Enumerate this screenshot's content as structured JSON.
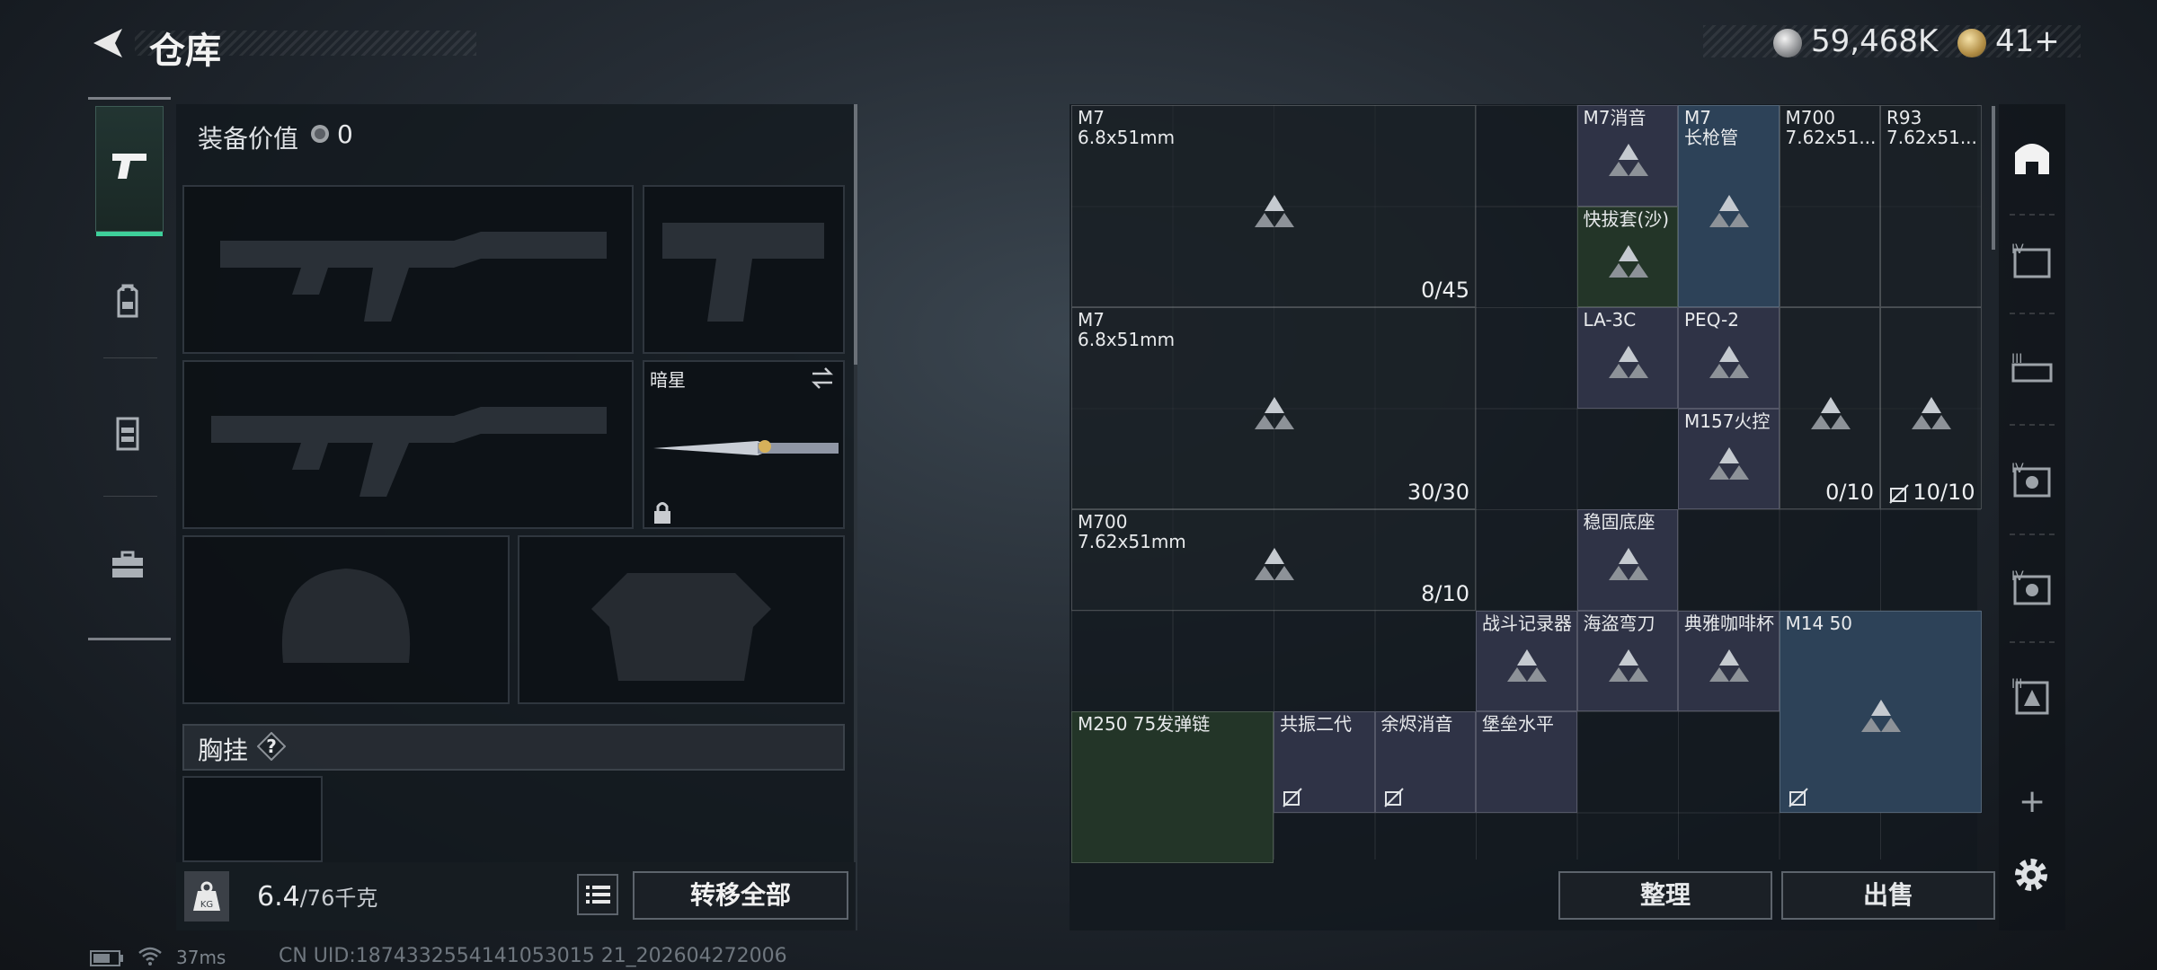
{
  "header": {
    "title": "仓库",
    "currency_value": "59,468K",
    "token_value": "41+"
  },
  "nav": {
    "items": [
      "weapon-tab",
      "backpack-tab",
      "vest-tab",
      "case-tab"
    ]
  },
  "equipment": {
    "value_label": "装备价值",
    "value": "0",
    "melee_name": "暗星",
    "chest_label": "胸挂",
    "chest_help": "?",
    "weight_value": "6.4",
    "weight_capacity": "/76千克",
    "transfer_all": "转移全部"
  },
  "storage": {
    "items": [
      {
        "name": "M7\n6.8x51mm",
        "count": "0/45"
      },
      {
        "name": "M7消音",
        "count": ""
      },
      {
        "name": "M7\n长枪管",
        "count": ""
      },
      {
        "name": "M700\n7.62x51...",
        "count": ""
      },
      {
        "name": "R93\n7.62x51...",
        "count": ""
      },
      {
        "name": "快拔套(沙)",
        "count": ""
      },
      {
        "name": "M7\n6.8x51mm",
        "count": "30/30"
      },
      {
        "name": "LA-3C",
        "count": ""
      },
      {
        "name": "PEQ-2",
        "count": ""
      },
      {
        "name": "M157火控",
        "count": ""
      },
      {
        "name": "M700\n7.62x51mm",
        "count": "8/10"
      },
      {
        "name": "稳固底座",
        "count": ""
      },
      {
        "name": "",
        "count": "0/10"
      },
      {
        "name": "",
        "count": "10/10"
      },
      {
        "name": "战斗记录器",
        "count": ""
      },
      {
        "name": "海盗弯刀",
        "count": ""
      },
      {
        "name": "典雅咖啡杯",
        "count": ""
      },
      {
        "name": "M14 50",
        "count": ""
      },
      {
        "name": "M250 75发弹链",
        "count": ""
      },
      {
        "name": "共振二代",
        "count": ""
      },
      {
        "name": "余烬消音",
        "count": ""
      },
      {
        "name": "堡垒水平",
        "count": ""
      }
    ],
    "sort_label": "整理",
    "sell_label": "出售"
  },
  "right_tabs": {
    "add": "+"
  },
  "status": {
    "ping": "37ms",
    "uid": "CN UID:1874332554141053015 21_202604272006"
  },
  "colors": {
    "accent_green": "#3ecf9a",
    "blue_item": "#2d4258",
    "purple_item": "#2f3346",
    "green_item": "#233528"
  }
}
